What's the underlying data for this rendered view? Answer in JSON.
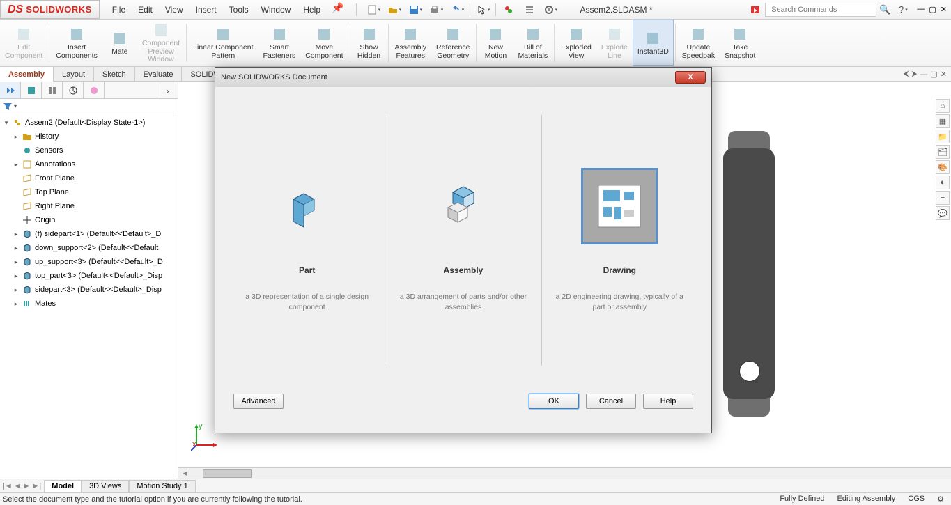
{
  "app": {
    "brand_prefix": "DS",
    "brand": "SOLIDWORKS"
  },
  "menu": [
    "File",
    "Edit",
    "View",
    "Insert",
    "Tools",
    "Window",
    "Help"
  ],
  "document_name": "Assem2.SLDASM *",
  "search": {
    "placeholder": "Search Commands"
  },
  "ribbon": [
    {
      "label": "Edit\nComponent",
      "disabled": true
    },
    {
      "label": "Insert\nComponents",
      "disabled": false
    },
    {
      "label": "Mate",
      "disabled": false
    },
    {
      "label": "Component\nPreview\nWindow",
      "disabled": true
    },
    {
      "label": "Linear Component\nPattern",
      "disabled": false
    },
    {
      "label": "Smart\nFasteners",
      "disabled": false
    },
    {
      "label": "Move\nComponent",
      "disabled": false
    },
    {
      "label": "Show\nHidden",
      "disabled": false
    },
    {
      "label": "Assembly\nFeatures",
      "disabled": false
    },
    {
      "label": "Reference\nGeometry",
      "disabled": false
    },
    {
      "label": "New\nMotion",
      "disabled": false
    },
    {
      "label": "Bill of\nMaterials",
      "disabled": false
    },
    {
      "label": "Exploded\nView",
      "disabled": false
    },
    {
      "label": "Explode\nLine",
      "disabled": true
    },
    {
      "label": "Instant3D",
      "disabled": false,
      "active": true
    },
    {
      "label": "Update\nSpeedpak",
      "disabled": false
    },
    {
      "label": "Take\nSnapshot",
      "disabled": false
    }
  ],
  "tabs": [
    "Assembly",
    "Layout",
    "Sketch",
    "Evaluate",
    "SOLIDWOR"
  ],
  "active_tab": "Assembly",
  "tree": {
    "root": "Assem2  (Default<Display State-1>)",
    "items": [
      {
        "icon": "folder",
        "label": "History",
        "exp": "▸",
        "indent": 1
      },
      {
        "icon": "sensor",
        "label": "Sensors",
        "indent": 1
      },
      {
        "icon": "note",
        "label": "Annotations",
        "exp": "▸",
        "indent": 1
      },
      {
        "icon": "plane",
        "label": "Front Plane",
        "indent": 1
      },
      {
        "icon": "plane",
        "label": "Top Plane",
        "indent": 1
      },
      {
        "icon": "plane",
        "label": "Right Plane",
        "indent": 1
      },
      {
        "icon": "origin",
        "label": "Origin",
        "indent": 1
      },
      {
        "icon": "part",
        "label": "(f) sidepart<1> (Default<<Default>_D",
        "exp": "▸",
        "indent": 1
      },
      {
        "icon": "part",
        "label": "down_support<2> (Default<<Default",
        "exp": "▸",
        "indent": 1
      },
      {
        "icon": "part",
        "label": "up_support<3> (Default<<Default>_D",
        "exp": "▸",
        "indent": 1
      },
      {
        "icon": "part",
        "label": "top_part<3> (Default<<Default>_Disp",
        "exp": "▸",
        "indent": 1
      },
      {
        "icon": "part",
        "label": "sidepart<3> (Default<<Default>_Disp",
        "exp": "▸",
        "indent": 1
      },
      {
        "icon": "mates",
        "label": "Mates",
        "exp": "▸",
        "indent": 1
      }
    ]
  },
  "bottom_tabs": [
    "Model",
    "3D Views",
    "Motion Study 1"
  ],
  "active_bottom_tab": "Model",
  "status": {
    "left": "Select the document type and the tutorial option if you are currently following the tutorial.",
    "right": [
      "Fully Defined",
      "Editing Assembly",
      "CGS"
    ]
  },
  "dialog": {
    "title": "New SOLIDWORKS Document",
    "options": [
      {
        "title": "Part",
        "desc": "a 3D representation of a single design component",
        "selected": false
      },
      {
        "title": "Assembly",
        "desc": "a 3D arrangement of parts and/or other assemblies",
        "selected": false
      },
      {
        "title": "Drawing",
        "desc": "a 2D engineering drawing, typically of a part or assembly",
        "selected": true
      }
    ],
    "buttons": {
      "advanced": "Advanced",
      "ok": "OK",
      "cancel": "Cancel",
      "help": "Help"
    }
  },
  "triad": {
    "x": "x",
    "y": "y",
    "z": "z"
  }
}
